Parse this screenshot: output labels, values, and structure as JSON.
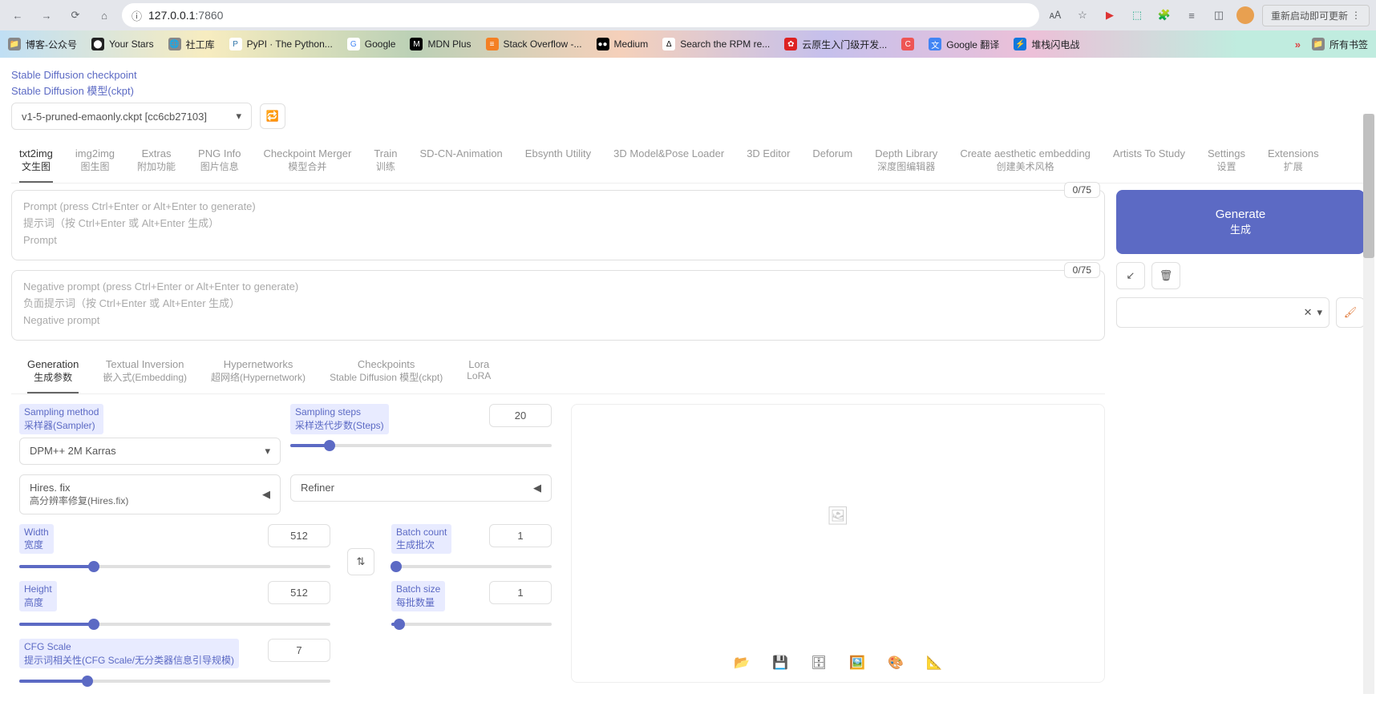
{
  "browser": {
    "url_host": "127.0.0.1",
    "url_port": ":7860",
    "update_btn": "重新启动即可更新",
    "all_bookmarks": "所有书签"
  },
  "bookmarks": [
    {
      "label": "博客-公众号"
    },
    {
      "label": "Your Stars"
    },
    {
      "label": "社工库"
    },
    {
      "label": "PyPI · The Python..."
    },
    {
      "label": "Google"
    },
    {
      "label": "MDN Plus"
    },
    {
      "label": "Stack Overflow -..."
    },
    {
      "label": "Medium"
    },
    {
      "label": "Search the RPM re..."
    },
    {
      "label": "云原生入门级开发..."
    },
    {
      "label": ""
    },
    {
      "label": "Google 翻译"
    },
    {
      "label": "堆栈闪电战"
    }
  ],
  "checkpoint": {
    "label_en": "Stable Diffusion checkpoint",
    "label_zh": "Stable Diffusion 模型(ckpt)",
    "value": "v1-5-pruned-emaonly.ckpt [cc6cb27103]"
  },
  "main_tabs": [
    {
      "en": "txt2img",
      "zh": "文生图",
      "active": true
    },
    {
      "en": "img2img",
      "zh": "图生图"
    },
    {
      "en": "Extras",
      "zh": "附加功能"
    },
    {
      "en": "PNG Info",
      "zh": "图片信息"
    },
    {
      "en": "Checkpoint Merger",
      "zh": "模型合并"
    },
    {
      "en": "Train",
      "zh": "训练"
    },
    {
      "en": "SD-CN-Animation",
      "zh": ""
    },
    {
      "en": "Ebsynth Utility",
      "zh": ""
    },
    {
      "en": "3D Model&Pose Loader",
      "zh": ""
    },
    {
      "en": "3D Editor",
      "zh": ""
    },
    {
      "en": "Deforum",
      "zh": ""
    },
    {
      "en": "Depth Library",
      "zh": "深度图编辑器"
    },
    {
      "en": "Create aesthetic embedding",
      "zh": "创建美术风格"
    },
    {
      "en": "Artists To Study",
      "zh": ""
    },
    {
      "en": "Settings",
      "zh": "设置"
    },
    {
      "en": "Extensions",
      "zh": "扩展"
    }
  ],
  "prompt": {
    "placeholder_en": "Prompt (press Ctrl+Enter or Alt+Enter to generate)",
    "placeholder_zh": "提示词（按 Ctrl+Enter 或 Alt+Enter 生成）",
    "placeholder_short": "Prompt",
    "tokens": "0/75"
  },
  "neg_prompt": {
    "placeholder_en": "Negative prompt (press Ctrl+Enter or Alt+Enter to generate)",
    "placeholder_zh": "负面提示词（按 Ctrl+Enter 或 Alt+Enter 生成）",
    "placeholder_short": "Negative prompt",
    "tokens": "0/75"
  },
  "generate": {
    "en": "Generate",
    "zh": "生成"
  },
  "sub_tabs": [
    {
      "en": "Generation",
      "zh": "生成参数",
      "active": true
    },
    {
      "en": "Textual Inversion",
      "zh": "嵌入式(Embedding)"
    },
    {
      "en": "Hypernetworks",
      "zh": "超网络(Hypernetwork)"
    },
    {
      "en": "Checkpoints",
      "zh": "Stable Diffusion 模型(ckpt)"
    },
    {
      "en": "Lora",
      "zh": "LoRA"
    }
  ],
  "params": {
    "sampler_label_en": "Sampling method",
    "sampler_label_zh": "采样器(Sampler)",
    "sampler_value": "DPM++ 2M Karras",
    "steps_label_en": "Sampling steps",
    "steps_label_zh": "采样迭代步数(Steps)",
    "steps_value": "20",
    "hires_en": "Hires. fix",
    "hires_zh": "高分辨率修复(Hires.fix)",
    "refiner": "Refiner",
    "width_en": "Width",
    "width_zh": "宽度",
    "width_value": "512",
    "height_en": "Height",
    "height_zh": "高度",
    "height_value": "512",
    "batch_count_en": "Batch count",
    "batch_count_zh": "生成批次",
    "batch_count_value": "1",
    "batch_size_en": "Batch size",
    "batch_size_zh": "每批数量",
    "batch_size_value": "1",
    "cfg_en": "CFG Scale",
    "cfg_zh": "提示词相关性(CFG Scale/无分类器信息引导规模)",
    "cfg_value": "7"
  }
}
